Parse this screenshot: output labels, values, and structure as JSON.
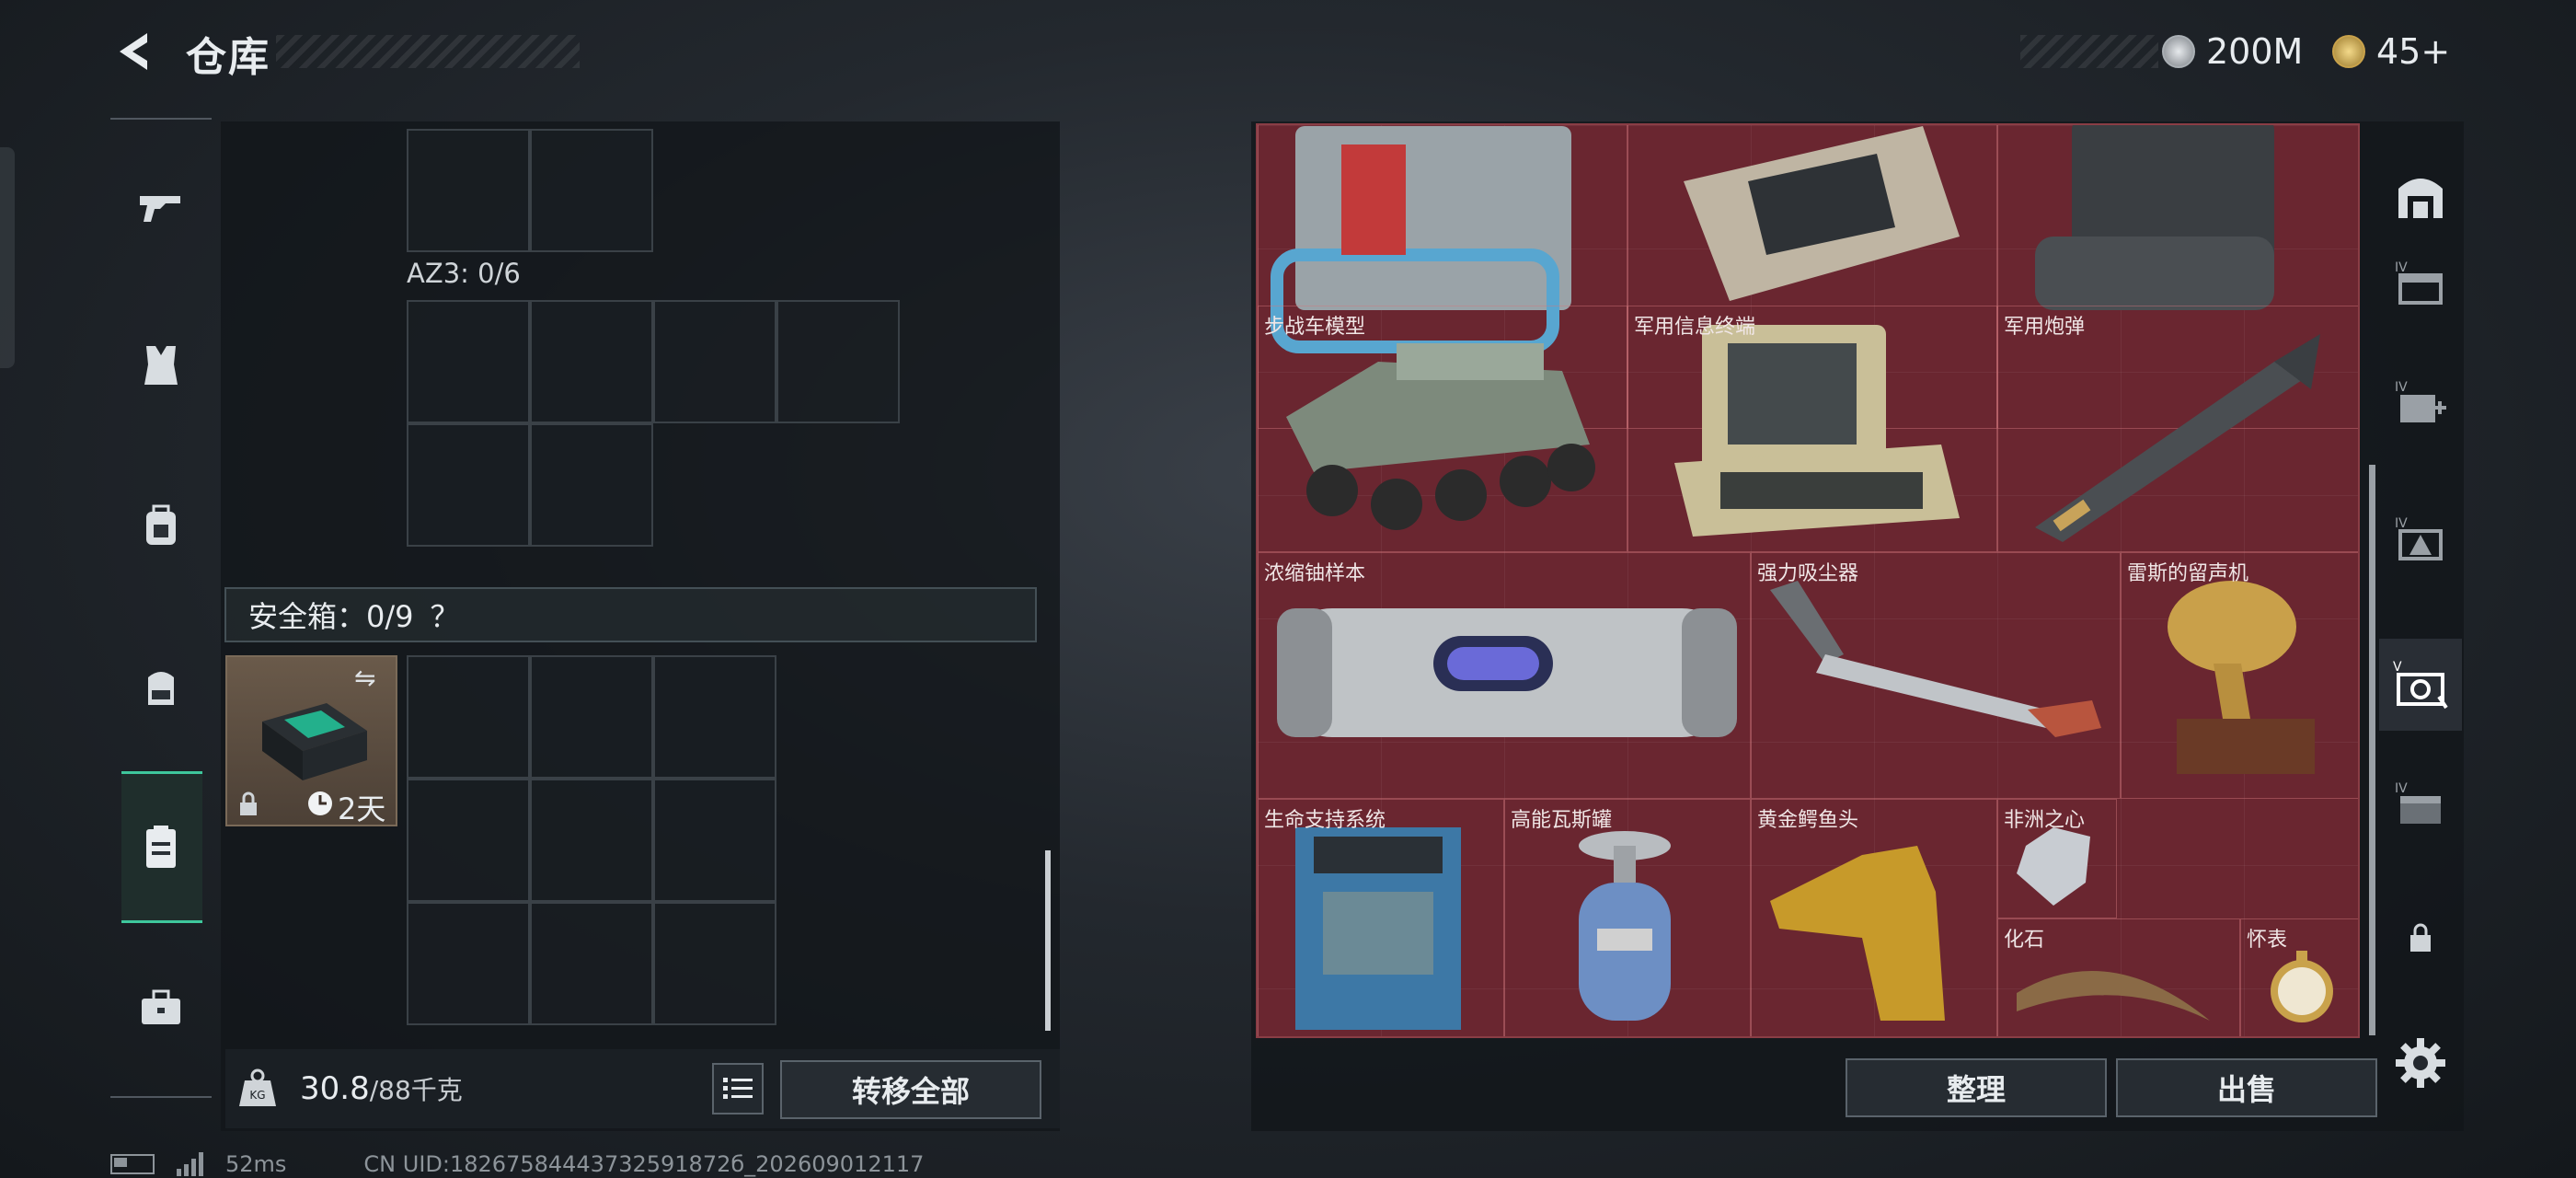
{
  "header": {
    "title": "仓库"
  },
  "currencies": [
    {
      "value": "200M",
      "icon": "silver-coin-icon",
      "color": "#c9cdd1"
    },
    {
      "value": "45+",
      "icon": "gold-triangle-coin-icon",
      "color": "#d6b056"
    }
  ],
  "left_nav": [
    "gun-icon",
    "armor-vest-icon",
    "backpack-alt-icon",
    "backpack-icon",
    "safebox-icon",
    "briefcase-icon"
  ],
  "storage": {
    "az3_label": "AZ3: 0/6",
    "safebox_label": "安全箱：0/9",
    "safebox_help": "？",
    "safebox_timer": "2天",
    "weight_value": "30.8",
    "weight_max": "/88千克",
    "transfer_all": "转移全部"
  },
  "inventory_items": [
    {
      "name": ""
    },
    {
      "name": ""
    },
    {
      "name": ""
    },
    {
      "name": "步战车模型"
    },
    {
      "name": "军用信息终端"
    },
    {
      "name": "军用炮弹"
    },
    {
      "name": "浓缩铀样本"
    },
    {
      "name": "强力吸尘器"
    },
    {
      "name": "雷斯的留声机"
    },
    {
      "name": "生命支持系统"
    },
    {
      "name": "高能瓦斯罐"
    },
    {
      "name": "黄金鳄鱼头"
    },
    {
      "name": "非洲之心"
    },
    {
      "name": "化石"
    },
    {
      "name": "怀表"
    }
  ],
  "actions": {
    "sort": "整理",
    "sell": "出售"
  },
  "right_nav": [
    "container-icon",
    "tier-iv-box-icon",
    "tier-iv-add-icon",
    "tier-iv-triangle-icon",
    "tier-v-safe-icon",
    "tier-iv-case-icon",
    "lock-icon"
  ],
  "status": {
    "ping": "52ms",
    "uid": "CN UID:18267584443732591872б_202609012117"
  },
  "colors": {
    "accent": "#3ec79c",
    "grid_bg": "#6a2630"
  }
}
